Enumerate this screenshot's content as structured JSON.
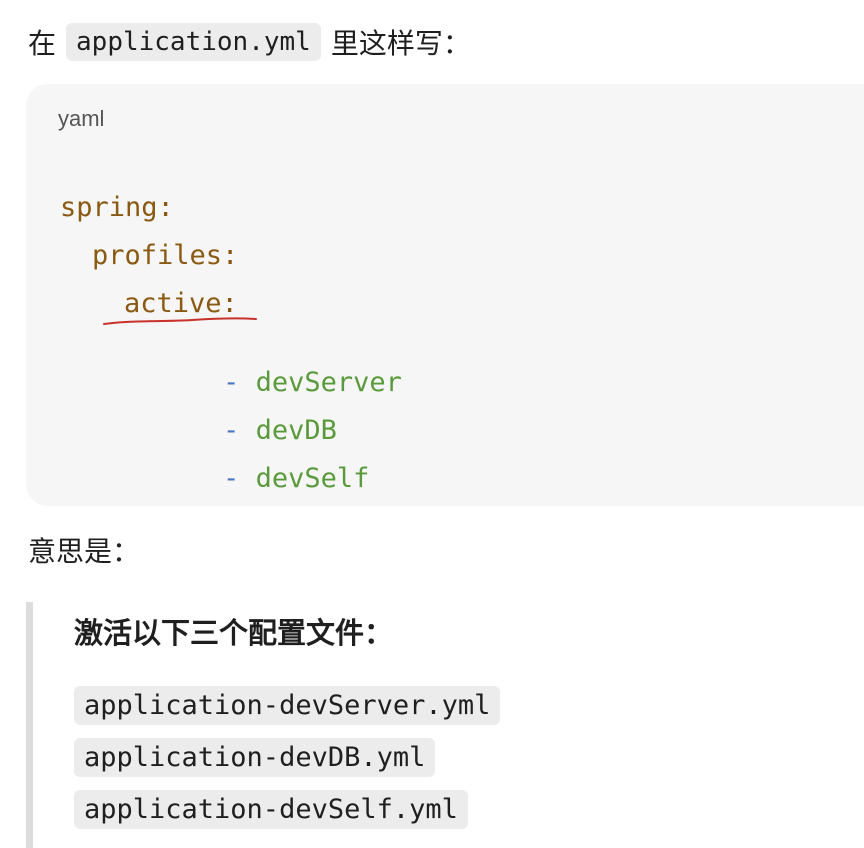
{
  "intro": {
    "prefix": "在",
    "filename": "application.yml",
    "suffix": "里这样写："
  },
  "code_block": {
    "language": "yaml",
    "lines": {
      "spring": "spring:",
      "profiles": "profiles:",
      "active": "active:",
      "dash": "-",
      "item1": "devServer",
      "item2": "devDB",
      "item3": "devSelf"
    },
    "colors": {
      "key": "#8a5a13",
      "dash": "#4a78c6",
      "value": "#5a9a3c",
      "handwritten_underline": "#c8322a"
    }
  },
  "meaning_label": "意思是：",
  "quote": {
    "title": "激活以下三个配置文件：",
    "files": [
      "application-devServer.yml",
      "application-devDB.yml",
      "application-devSelf.yml"
    ]
  }
}
